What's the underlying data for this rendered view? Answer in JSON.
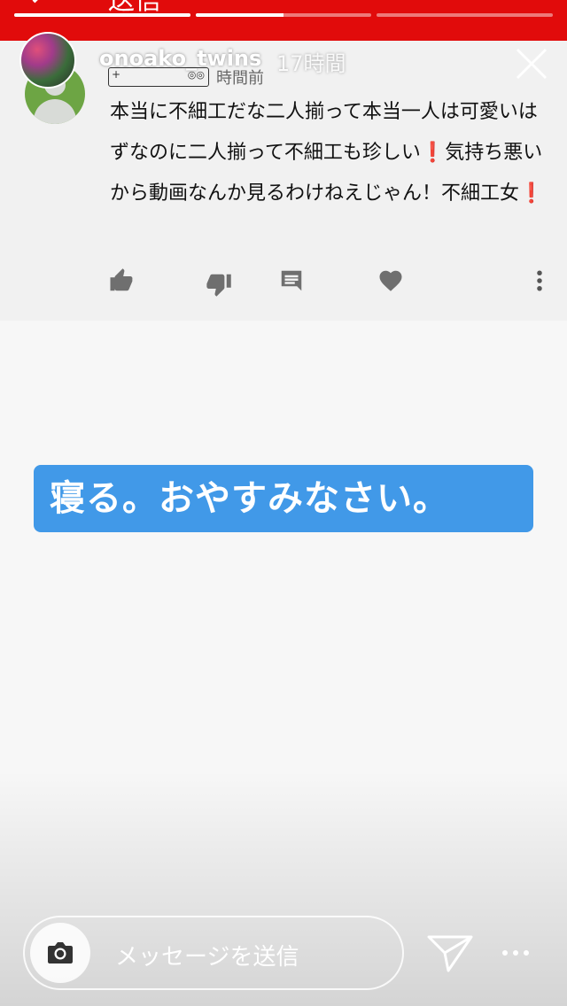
{
  "top_bar": {
    "title": "送信",
    "back_icon": "chevron-left-icon",
    "color": "#e10b0b"
  },
  "story": {
    "progress": [
      1.0,
      0.5,
      0.0
    ],
    "username": "onoako_twins",
    "timestamp": "17時間",
    "close_icon": "close-icon"
  },
  "comment": {
    "time": "時間前",
    "text": "本当に不細工だな二人揃って本当一人は可愛いはずなのに二人揃って不細工も珍しい❗気持ち悪いから動画なんか見るわけねえじゃん！不細工女❗",
    "actions": {
      "like_icon": "thumbs-up-icon",
      "dislike_icon": "thumbs-down-icon",
      "reply_icon": "comment-icon",
      "heart_icon": "heart-icon",
      "more_icon": "more-vertical-icon"
    }
  },
  "sticker": {
    "text": "寝る。おやすみなさい。",
    "color": "#4199e8"
  },
  "message_bar": {
    "placeholder": "メッセージを送信",
    "camera_icon": "camera-icon",
    "send_icon": "send-icon",
    "more_icon": "more-horizontal-icon"
  }
}
